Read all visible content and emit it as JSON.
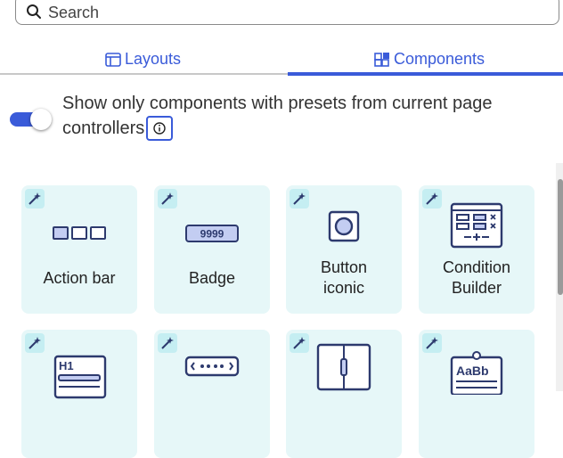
{
  "search": {
    "placeholder": "Search",
    "icon": "search-icon"
  },
  "tabs": [
    {
      "label": "Layouts",
      "icon": "layout-icon",
      "active": false
    },
    {
      "label": "Components",
      "icon": "components-icon",
      "active": true
    }
  ],
  "toggle": {
    "label": "Show only components with presets from current page controllers",
    "on": true
  },
  "components": [
    {
      "label": "Action bar",
      "icon": "action-bar-icon",
      "has_preset": true
    },
    {
      "label": "Badge",
      "icon": "badge-icon",
      "icon_text": "9999",
      "has_preset": true
    },
    {
      "label_line1": "Button",
      "label_line2": "iconic",
      "icon": "button-iconic-icon",
      "has_preset": true
    },
    {
      "label_line1": "Condition",
      "label_line2": "Builder",
      "icon": "condition-builder-icon",
      "has_preset": true
    },
    {
      "label": "",
      "icon": "heading-icon",
      "icon_text": "H1",
      "has_preset": true
    },
    {
      "label": "",
      "icon": "pagination-dots-icon",
      "has_preset": true
    },
    {
      "label": "",
      "icon": "divider-panel-icon",
      "has_preset": true
    },
    {
      "label": "",
      "icon": "typography-icon",
      "icon_text": "AaBb",
      "has_preset": true
    }
  ],
  "colors": {
    "accent": "#3a5bd9",
    "card_bg": "#e6f7f8",
    "icon_navy": "#2d3a6e"
  }
}
